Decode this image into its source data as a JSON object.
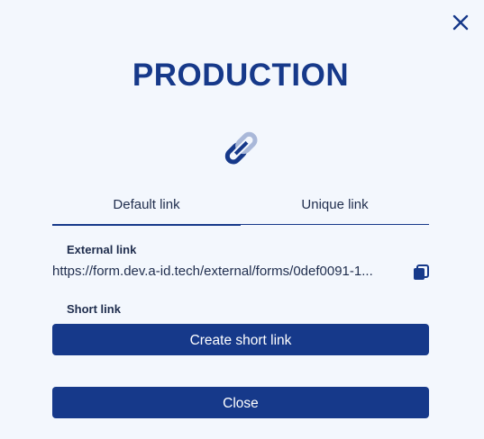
{
  "dialog": {
    "title": "PRODUCTION",
    "close_icon": "close-x-icon",
    "link_icon": "link-chain-icon"
  },
  "tabs": [
    {
      "label": "Default link",
      "active": true
    },
    {
      "label": "Unique link",
      "active": false
    }
  ],
  "external": {
    "label": "External link",
    "url": "https://form.dev.a-id.tech/external/forms/0def0091-1...",
    "copy_icon": "copy-icon"
  },
  "short": {
    "label": "Short link",
    "create_label": "Create short link"
  },
  "footer": {
    "close_label": "Close"
  },
  "colors": {
    "accent": "#16398a",
    "background": "#f3f7fd",
    "text": "#1f2d4d",
    "button_text": "#ffffff"
  }
}
